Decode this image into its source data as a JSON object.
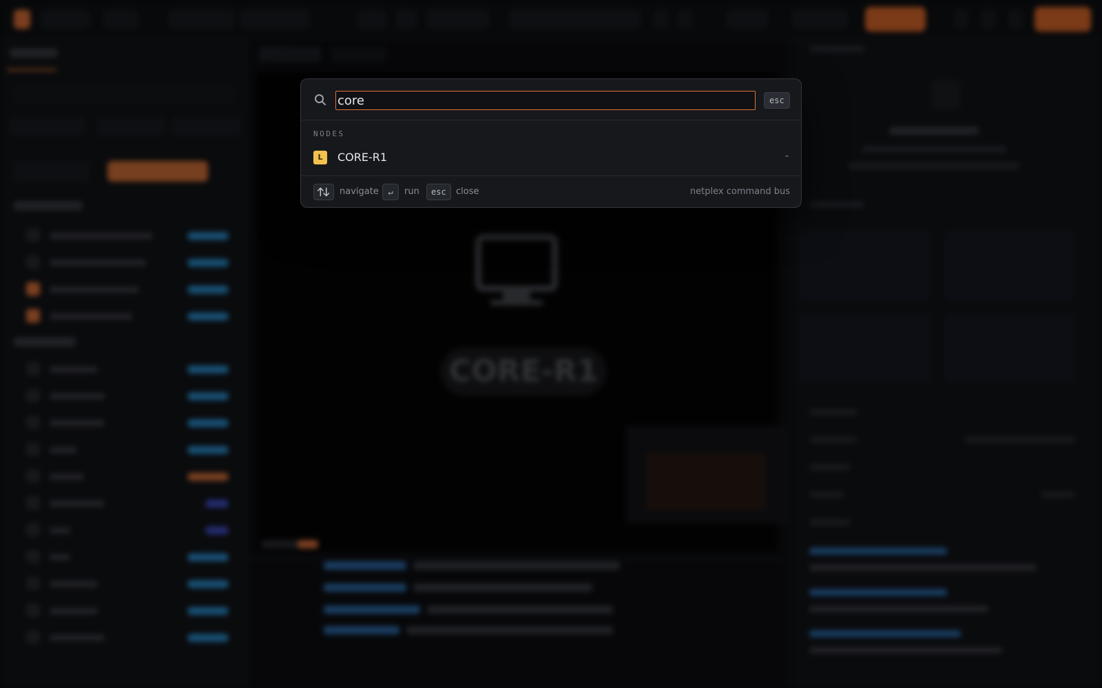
{
  "palette": {
    "query": "core",
    "esc_label": "esc",
    "section_label": "NODES",
    "results": [
      {
        "badge": "L",
        "name": "CORE-R1",
        "meta": "-"
      }
    ],
    "footer": {
      "navigate_label": "navigate",
      "run_label": "run",
      "close_key": "esc",
      "close_label": "close",
      "brand": "netplex command bus"
    }
  },
  "canvas": {
    "node_label": "CORE-R1"
  },
  "colors": {
    "accent": "#e0733a",
    "badge": "#f2c14e",
    "panel": "#16181c"
  },
  "icons": {
    "search": "search-icon",
    "navigate": "arrows-up-down-icon",
    "enter": "enter-icon",
    "node": "monitor-icon"
  }
}
